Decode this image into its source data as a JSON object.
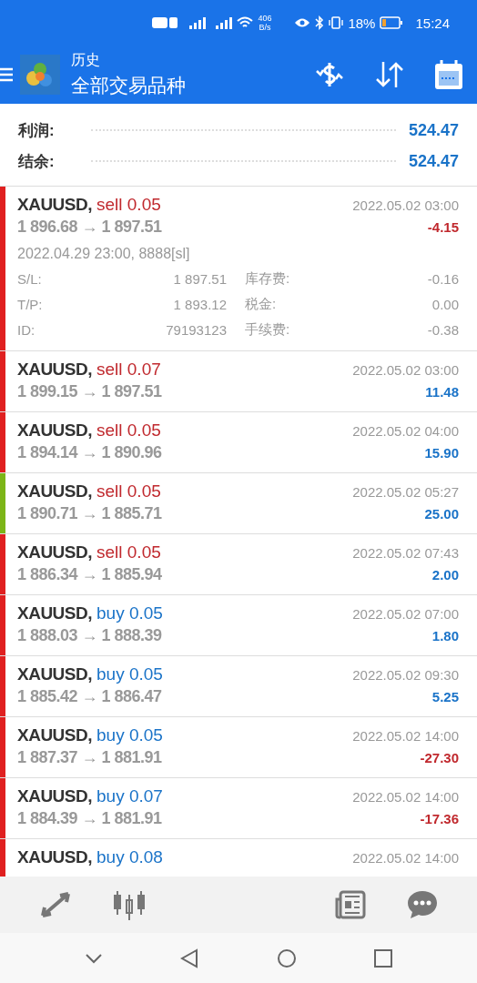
{
  "status_bar": {
    "network_speed": "406",
    "network_unit": "B/s",
    "battery": "18%",
    "time": "15:24"
  },
  "header": {
    "title": "历史",
    "subtitle": "全部交易品种"
  },
  "summary": [
    {
      "label": "利润:",
      "value": "524.47"
    },
    {
      "label": "结余:",
      "value": "524.47"
    }
  ],
  "trades": [
    {
      "symbol": "XAUUSD,",
      "kind": "sell",
      "volume": "sell 0.05",
      "prices": "1 896.68 → 1 897.51",
      "time": "2022.05.02 03:00",
      "profit": "-4.15",
      "loss": true,
      "color": "#e02020",
      "expanded": true,
      "open_info": "2022.04.29 23:00, 8888[sl]",
      "details": [
        {
          "label": "S/L:",
          "value": "1 897.51",
          "label2": "库存费:",
          "value2": "-0.16"
        },
        {
          "label": "T/P:",
          "value": "1 893.12",
          "label2": "税金:",
          "value2": "0.00"
        },
        {
          "label": "ID:",
          "value": "79193123",
          "label2": "手续费:",
          "value2": "-0.38"
        }
      ]
    },
    {
      "symbol": "XAUUSD,",
      "kind": "sell",
      "volume": "sell 0.07",
      "prices": "1 899.15 → 1 897.51",
      "time": "2022.05.02 03:00",
      "profit": "11.48",
      "loss": false,
      "color": "#e02020",
      "expanded": false
    },
    {
      "symbol": "XAUUSD,",
      "kind": "sell",
      "volume": "sell 0.05",
      "prices": "1 894.14 → 1 890.96",
      "time": "2022.05.02 04:00",
      "profit": "15.90",
      "loss": false,
      "color": "#e02020",
      "expanded": false
    },
    {
      "symbol": "XAUUSD,",
      "kind": "sell",
      "volume": "sell 0.05",
      "prices": "1 890.71 → 1 885.71",
      "time": "2022.05.02 05:27",
      "profit": "25.00",
      "loss": false,
      "color": "#7cb518",
      "expanded": false
    },
    {
      "symbol": "XAUUSD,",
      "kind": "sell",
      "volume": "sell 0.05",
      "prices": "1 886.34 → 1 885.94",
      "time": "2022.05.02 07:43",
      "profit": "2.00",
      "loss": false,
      "color": "#e02020",
      "expanded": false
    },
    {
      "symbol": "XAUUSD,",
      "kind": "buy",
      "volume": "buy 0.05",
      "prices": "1 888.03 → 1 888.39",
      "time": "2022.05.02 07:00",
      "profit": "1.80",
      "loss": false,
      "color": "#e02020",
      "expanded": false
    },
    {
      "symbol": "XAUUSD,",
      "kind": "buy",
      "volume": "buy 0.05",
      "prices": "1 885.42 → 1 886.47",
      "time": "2022.05.02 09:30",
      "profit": "5.25",
      "loss": false,
      "color": "#e02020",
      "expanded": false
    },
    {
      "symbol": "XAUUSD,",
      "kind": "buy",
      "volume": "buy 0.05",
      "prices": "1 887.37 → 1 881.91",
      "time": "2022.05.02 14:00",
      "profit": "-27.30",
      "loss": true,
      "color": "#e02020",
      "expanded": false
    },
    {
      "symbol": "XAUUSD,",
      "kind": "buy",
      "volume": "buy 0.07",
      "prices": "1 884.39 → 1 881.91",
      "time": "2022.05.02 14:00",
      "profit": "-17.36",
      "loss": true,
      "color": "#e02020",
      "expanded": false
    },
    {
      "symbol": "XAUUSD,",
      "kind": "buy",
      "volume": "buy 0.08",
      "time": "2022.05.02 14:00",
      "color": "#e02020"
    }
  ]
}
